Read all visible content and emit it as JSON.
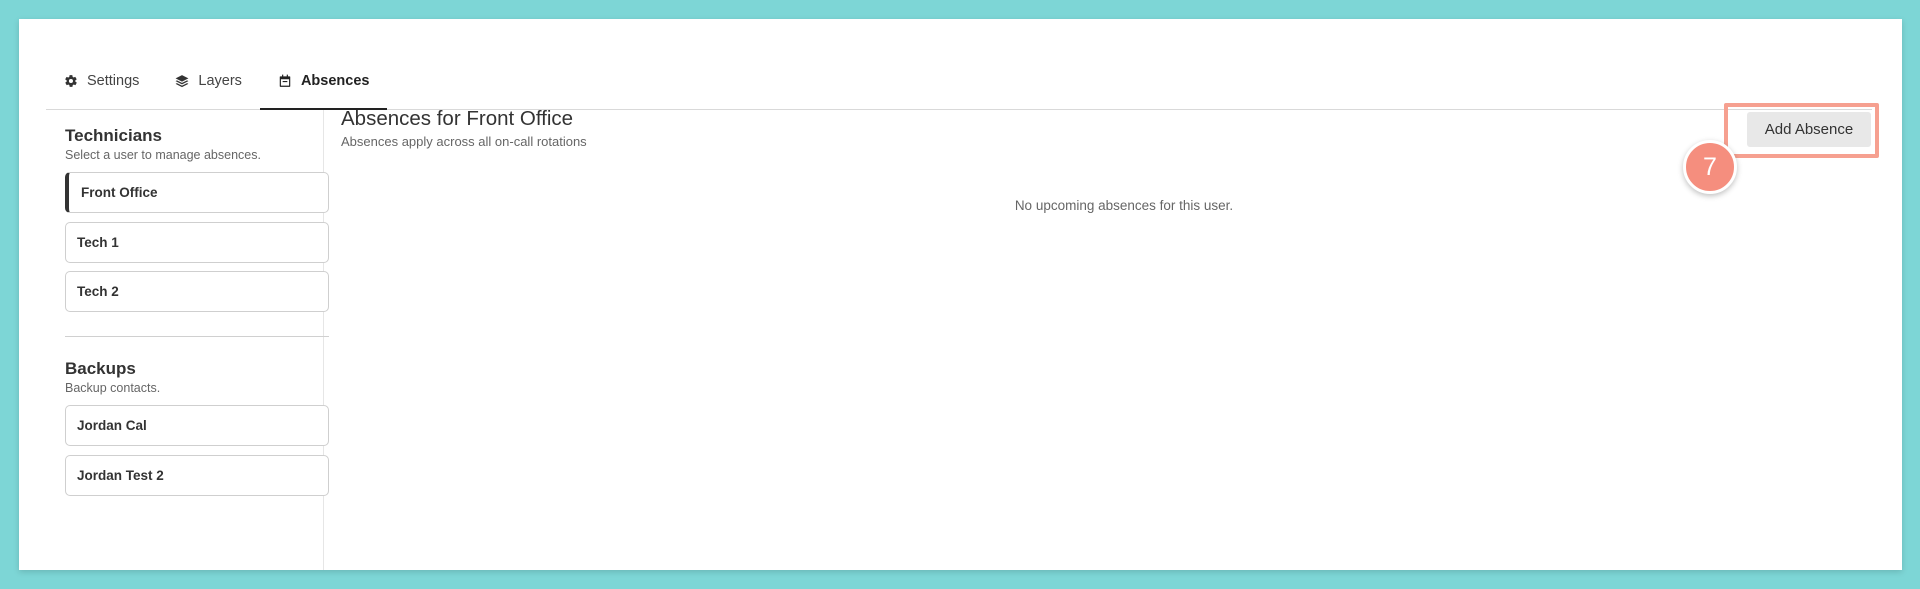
{
  "tabs": [
    {
      "label": "Settings",
      "icon": "gear-icon"
    },
    {
      "label": "Layers",
      "icon": "layers-icon"
    },
    {
      "label": "Absences",
      "icon": "calendar-icon",
      "active": true
    }
  ],
  "technicians": {
    "title": "Technicians",
    "subtitle": "Select a user to manage absences.",
    "users": [
      "Front Office",
      "Tech 1",
      "Tech 2"
    ],
    "selected": "Front Office"
  },
  "backups": {
    "title": "Backups",
    "subtitle": "Backup contacts.",
    "users": [
      "Jordan Cal",
      "Jordan Test 2"
    ]
  },
  "main": {
    "title": "Absences for Front Office",
    "subtitle": "Absences apply across all on-call rotations",
    "empty_message": "No upcoming absences for this user.",
    "add_button": "Add Absence"
  },
  "annotation": {
    "step_number": "7",
    "highlight_color": "#f6a090",
    "badge_color": "#f58e7e"
  },
  "colors": {
    "background": "#7dd6d6",
    "accent": "#222222"
  }
}
